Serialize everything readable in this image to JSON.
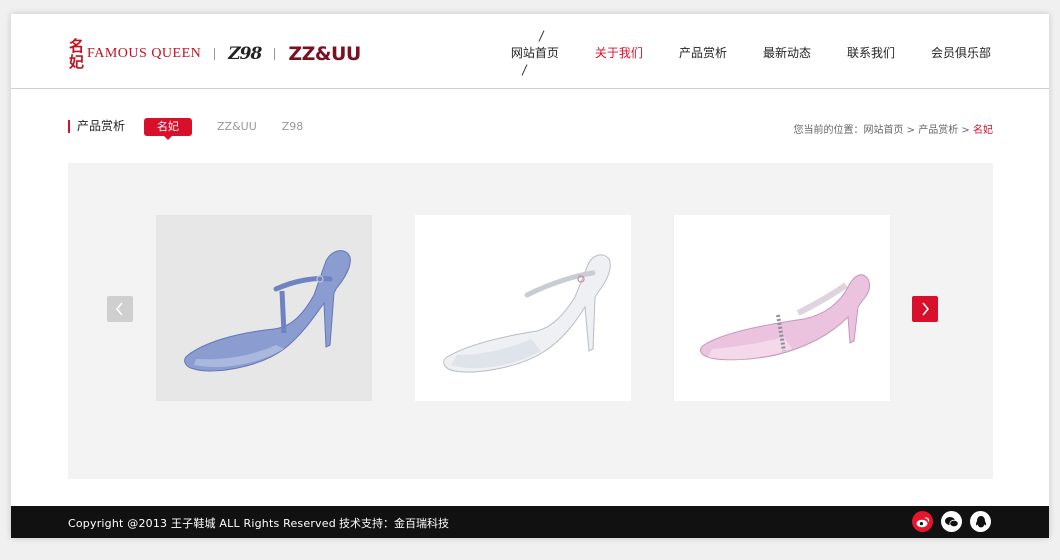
{
  "header": {
    "logo_mingfei_mark": "名妃",
    "logo_mingfei_text": "FAMOUS QUEEN",
    "logo_z98": "Z98",
    "logo_zzuu": "ZZ&UU",
    "nav": [
      {
        "label": "网站首页"
      },
      {
        "label": "关于我们"
      },
      {
        "label": "产品赏析"
      },
      {
        "label": "最新动态"
      },
      {
        "label": "联系我们"
      },
      {
        "label": "会员俱乐部"
      }
    ],
    "accent_color": "#d8102c"
  },
  "section": {
    "title": "产品赏析",
    "tabs": [
      {
        "label": "名妃",
        "active": true
      },
      {
        "label": "ZZ&UU",
        "active": false
      },
      {
        "label": "Z98",
        "active": false
      }
    ],
    "breadcrumb": {
      "prefix": "您当前的位置：",
      "home": "网站首页",
      "sep1": " > ",
      "category": "产品赏析",
      "sep2": " > ",
      "current": "名妃"
    }
  },
  "gallery": {
    "products": [
      {
        "icon": "blue-t-strap-heel-image",
        "color": "#8fa3d6"
      },
      {
        "icon": "white-mary-jane-heel-image",
        "color": "#e9ecf2"
      },
      {
        "icon": "pink-pump-heel-image",
        "color": "#e9c6e0"
      }
    ],
    "prev_icon": "chevron-left-icon",
    "next_icon": "chevron-right-icon"
  },
  "footer": {
    "copyright": "Copyright @2013 王子鞋城 ALL Rights Reserved",
    "support": "技术支持：金百瑞科技",
    "socials": [
      "weibo-icon",
      "wechat-icon",
      "qq-icon"
    ]
  }
}
